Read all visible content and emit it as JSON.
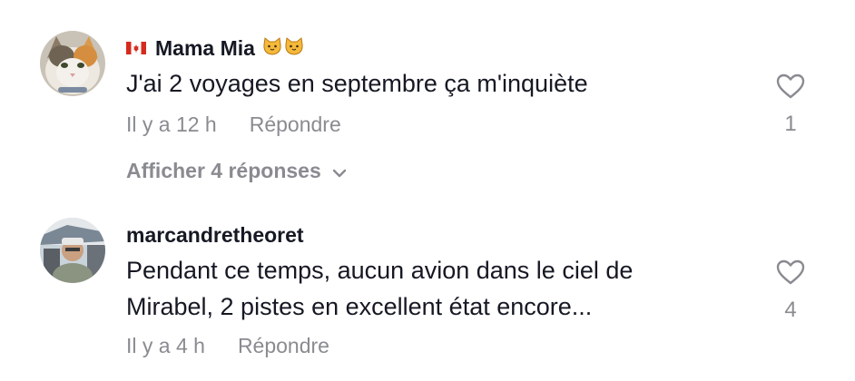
{
  "comments": [
    {
      "flag": "canada-flag-icon",
      "username": "Mama Mia",
      "emojis": [
        "cat-face-icon",
        "cat-face-icon"
      ],
      "text": "J'ai 2 voyages en septembre ça m'inquiète",
      "time": "Il y a 12 h",
      "reply_label": "Répondre",
      "likes": "1",
      "view_replies_label": "Afficher 4 réponses"
    },
    {
      "username": "marcandretheoret",
      "text": "Pendant ce temps, aucun avion dans le ciel de Mirabel, 2 pistes en excellent état encore...",
      "time": "Il y a 4 h",
      "reply_label": "Répondre",
      "likes": "4"
    }
  ],
  "colors": {
    "text_primary": "#161823",
    "text_secondary": "#8a8b91"
  }
}
